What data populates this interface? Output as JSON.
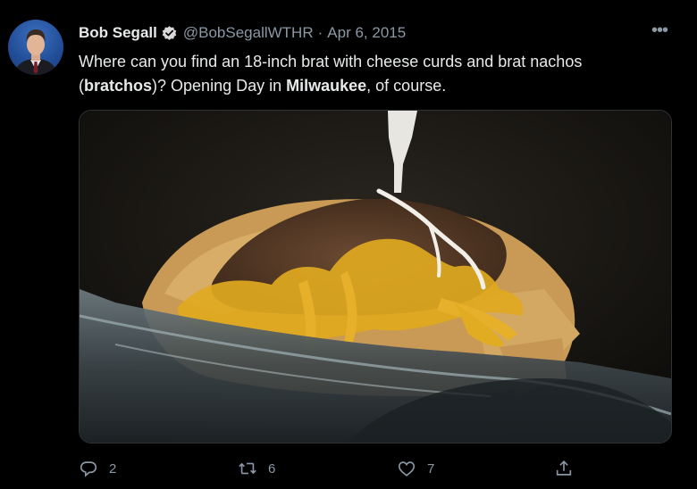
{
  "tweet": {
    "author_name": "Bob Segall",
    "handle": "@BobSegallWTHR",
    "separator": "·",
    "date": "Apr 6, 2015",
    "more_label": "•••",
    "text_part1": "Where can you find an 18-inch brat with cheese curds and brat nachos (",
    "text_bold1": "bratchos",
    "text_part2": ")? Opening Day in ",
    "text_bold2": "Milwaukee",
    "text_part3": ", of course."
  },
  "actions": {
    "reply_count": "2",
    "retweet_count": "6",
    "like_count": "7"
  },
  "icons": {
    "verified": "verified-badge-icon",
    "more": "more-icon",
    "reply": "reply-icon",
    "retweet": "retweet-icon",
    "like": "like-icon",
    "share": "share-icon"
  },
  "colors": {
    "background": "#000000",
    "text_primary": "#e7e9ea",
    "text_secondary": "#8b98a5",
    "border": "#2f3336"
  }
}
